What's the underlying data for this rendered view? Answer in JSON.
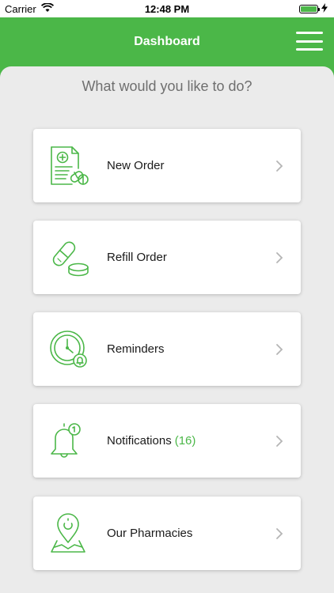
{
  "status_bar": {
    "carrier": "Carrier",
    "time": "12:48 PM"
  },
  "nav": {
    "title": "Dashboard"
  },
  "main": {
    "prompt": "What would you like to do?",
    "items": [
      {
        "label": "New Order",
        "icon": "prescription-icon"
      },
      {
        "label": "Refill Order",
        "icon": "pill-icon"
      },
      {
        "label": "Reminders",
        "icon": "clock-icon"
      },
      {
        "label": "Notifications",
        "count": "(16)",
        "icon": "bell-icon"
      },
      {
        "label": "Our Pharmacies",
        "icon": "map-pin-icon"
      }
    ]
  },
  "colors": {
    "accent": "#4bb748",
    "background": "#ebebeb",
    "card": "#ffffff",
    "chevron": "#b5b5b5"
  }
}
